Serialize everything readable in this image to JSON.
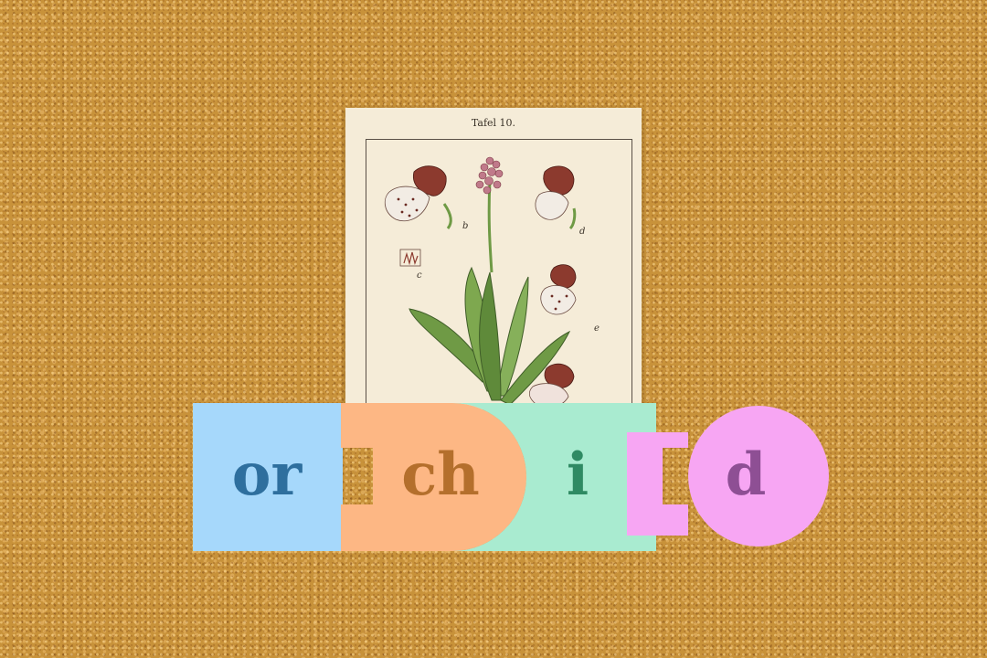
{
  "plate": {
    "title": "Tafel 10.",
    "figure_labels": [
      "b",
      "c",
      "d",
      "e"
    ]
  },
  "word_tiles": [
    {
      "text": "or",
      "fill": "#a6d8fb",
      "text_color": "#2e6f9e"
    },
    {
      "text": "ch",
      "fill": "#fdb784",
      "text_color": "#b46f2c"
    },
    {
      "text": "i",
      "fill": "#a9ebd0",
      "text_color": "#2f8a63"
    },
    {
      "text": "d",
      "fill": "#f7a6f3",
      "text_color": "#8e4f94"
    }
  ],
  "colors": {
    "corkboard": "#c8923a",
    "card": "#f5ecd8"
  }
}
